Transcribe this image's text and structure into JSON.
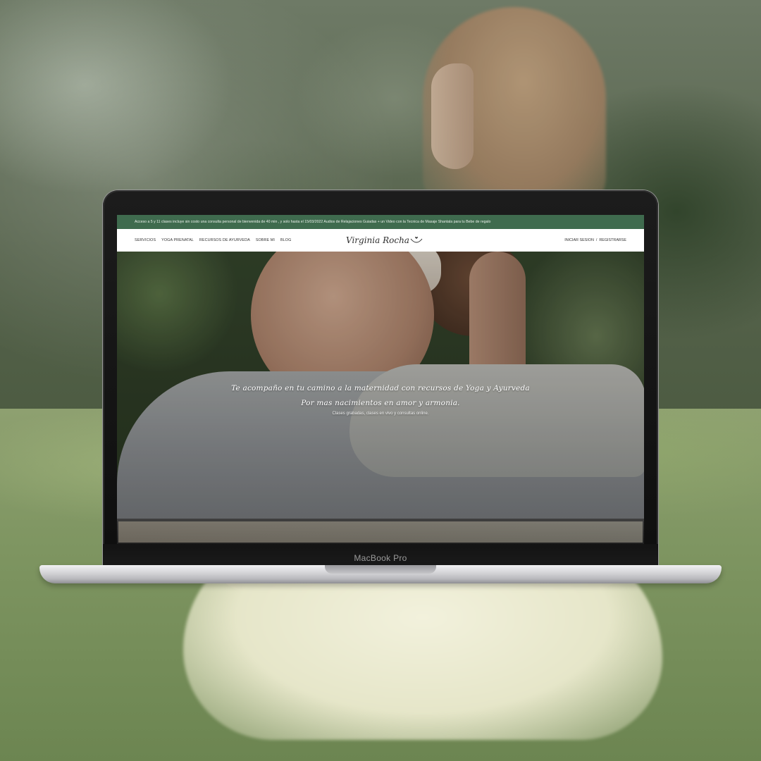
{
  "site": {
    "announcement": "Acceso a 5 y 11 clases incluye sin costo una consulta personal de bienvenida de 40 min , y solo hasta el 15/03/2022 Audios de Relajaciones Guiadas + un Video con la Tecnica de Masaje Shantala para tu Bebe de regalo",
    "nav": {
      "items": [
        {
          "label": "SERVICIOS"
        },
        {
          "label": "YOGA PRENATAL"
        },
        {
          "label": "RECURSOS DE AYURVEDA"
        },
        {
          "label": "SOBRE MI"
        },
        {
          "label": "BLOG"
        }
      ],
      "brand": "Virginia Rocha",
      "login": "INICIAR SESION",
      "separator": "/",
      "register": "REGISTRARSE"
    },
    "hero": {
      "line1": "Te acompaño en tu camino a la maternidad con recursos de Yoga y Ayurveda",
      "line2": "Por mas nacimientos en amor y armonia.",
      "subtitle": "Clases grabadas, clases en vivo y consultas online."
    },
    "colors": {
      "announcement_bg": "#3f6b4e",
      "nav_bg": "#ffffff",
      "hero_text": "#ffffff"
    }
  },
  "device": {
    "label": "MacBook Pro"
  }
}
